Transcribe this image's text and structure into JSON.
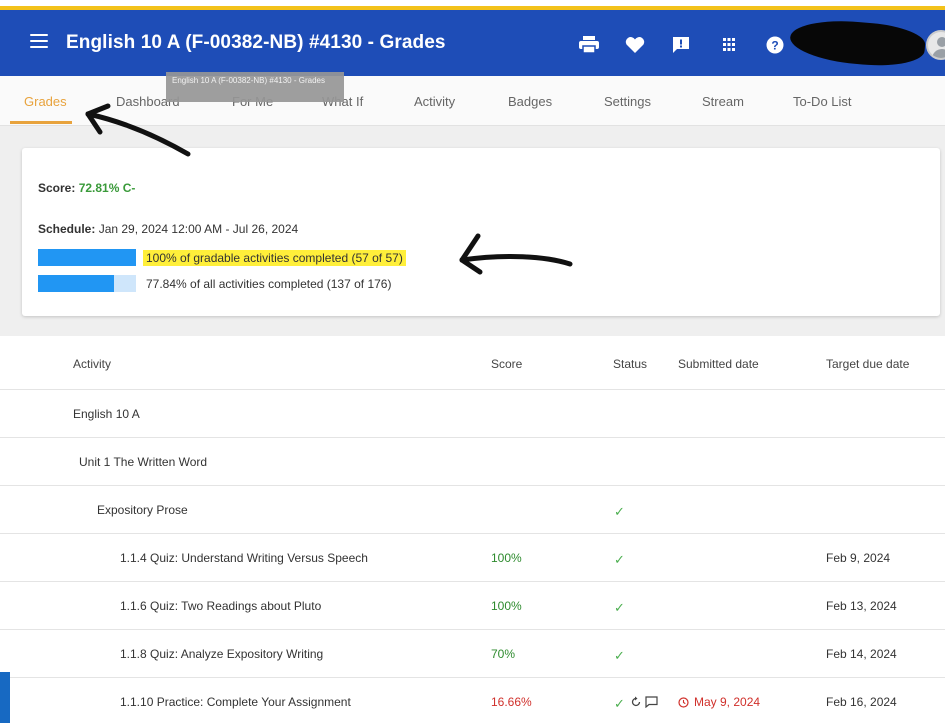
{
  "appbar": {
    "title": "English 10 A (F-00382-NB) #4130 - Grades",
    "icons": [
      "menu-icon",
      "print-icon",
      "heart-icon",
      "feedback-icon",
      "apps-icon",
      "help-icon"
    ],
    "tooltip": "English 10 A (F-00382-NB) #4130 - Grades",
    "bg_color": "#1e4db7"
  },
  "tabs": [
    "Grades",
    "Dashboard",
    "For Me",
    "What If",
    "Activity",
    "Badges",
    "Settings",
    "Stream",
    "To-Do List"
  ],
  "active_tab": "Grades",
  "summary": {
    "score_label": "Score:",
    "score_value": "72.81% C-",
    "schedule_label": "Schedule:",
    "schedule_value": "Jan 29, 2024 12:00 AM - Jul 26, 2024",
    "progress": [
      {
        "label": "100% of gradable activities completed (57 of 57)",
        "fraction": 1.0
      },
      {
        "label": "77.84% of all activities completed (137 of 176)",
        "fraction": 0.7784
      }
    ]
  },
  "table": {
    "headers": [
      "Activity",
      "Score",
      "Status",
      "Submitted date",
      "Target due date"
    ],
    "rows": [
      {
        "activity": "English 10 A",
        "score": "",
        "status": "",
        "submitted": "",
        "due": ""
      },
      {
        "activity": "Unit 1 The Written Word",
        "score": "",
        "status": "",
        "submitted": "",
        "due": ""
      },
      {
        "activity": "Expository Prose",
        "score": "",
        "status": "✓",
        "submitted": "",
        "due": ""
      },
      {
        "activity": "1.1.4 Quiz: Understand Writing Versus Speech",
        "score": "100%",
        "status": "✓",
        "submitted": "",
        "due": "Feb 9, 2024"
      },
      {
        "activity": "1.1.6 Quiz: Two Readings about Pluto",
        "score": "100%",
        "status": "✓",
        "submitted": "",
        "due": "Feb 13, 2024"
      },
      {
        "activity": "1.1.8 Quiz: Analyze Expository Writing",
        "score": "70%",
        "status": "✓",
        "submitted": "",
        "due": "Feb 14, 2024"
      },
      {
        "activity": "1.1.10 Practice: Complete Your Assignment",
        "score": "16.66%",
        "status": "✓",
        "submitted": "May 9, 2024",
        "due": "Feb 16, 2024"
      }
    ]
  }
}
